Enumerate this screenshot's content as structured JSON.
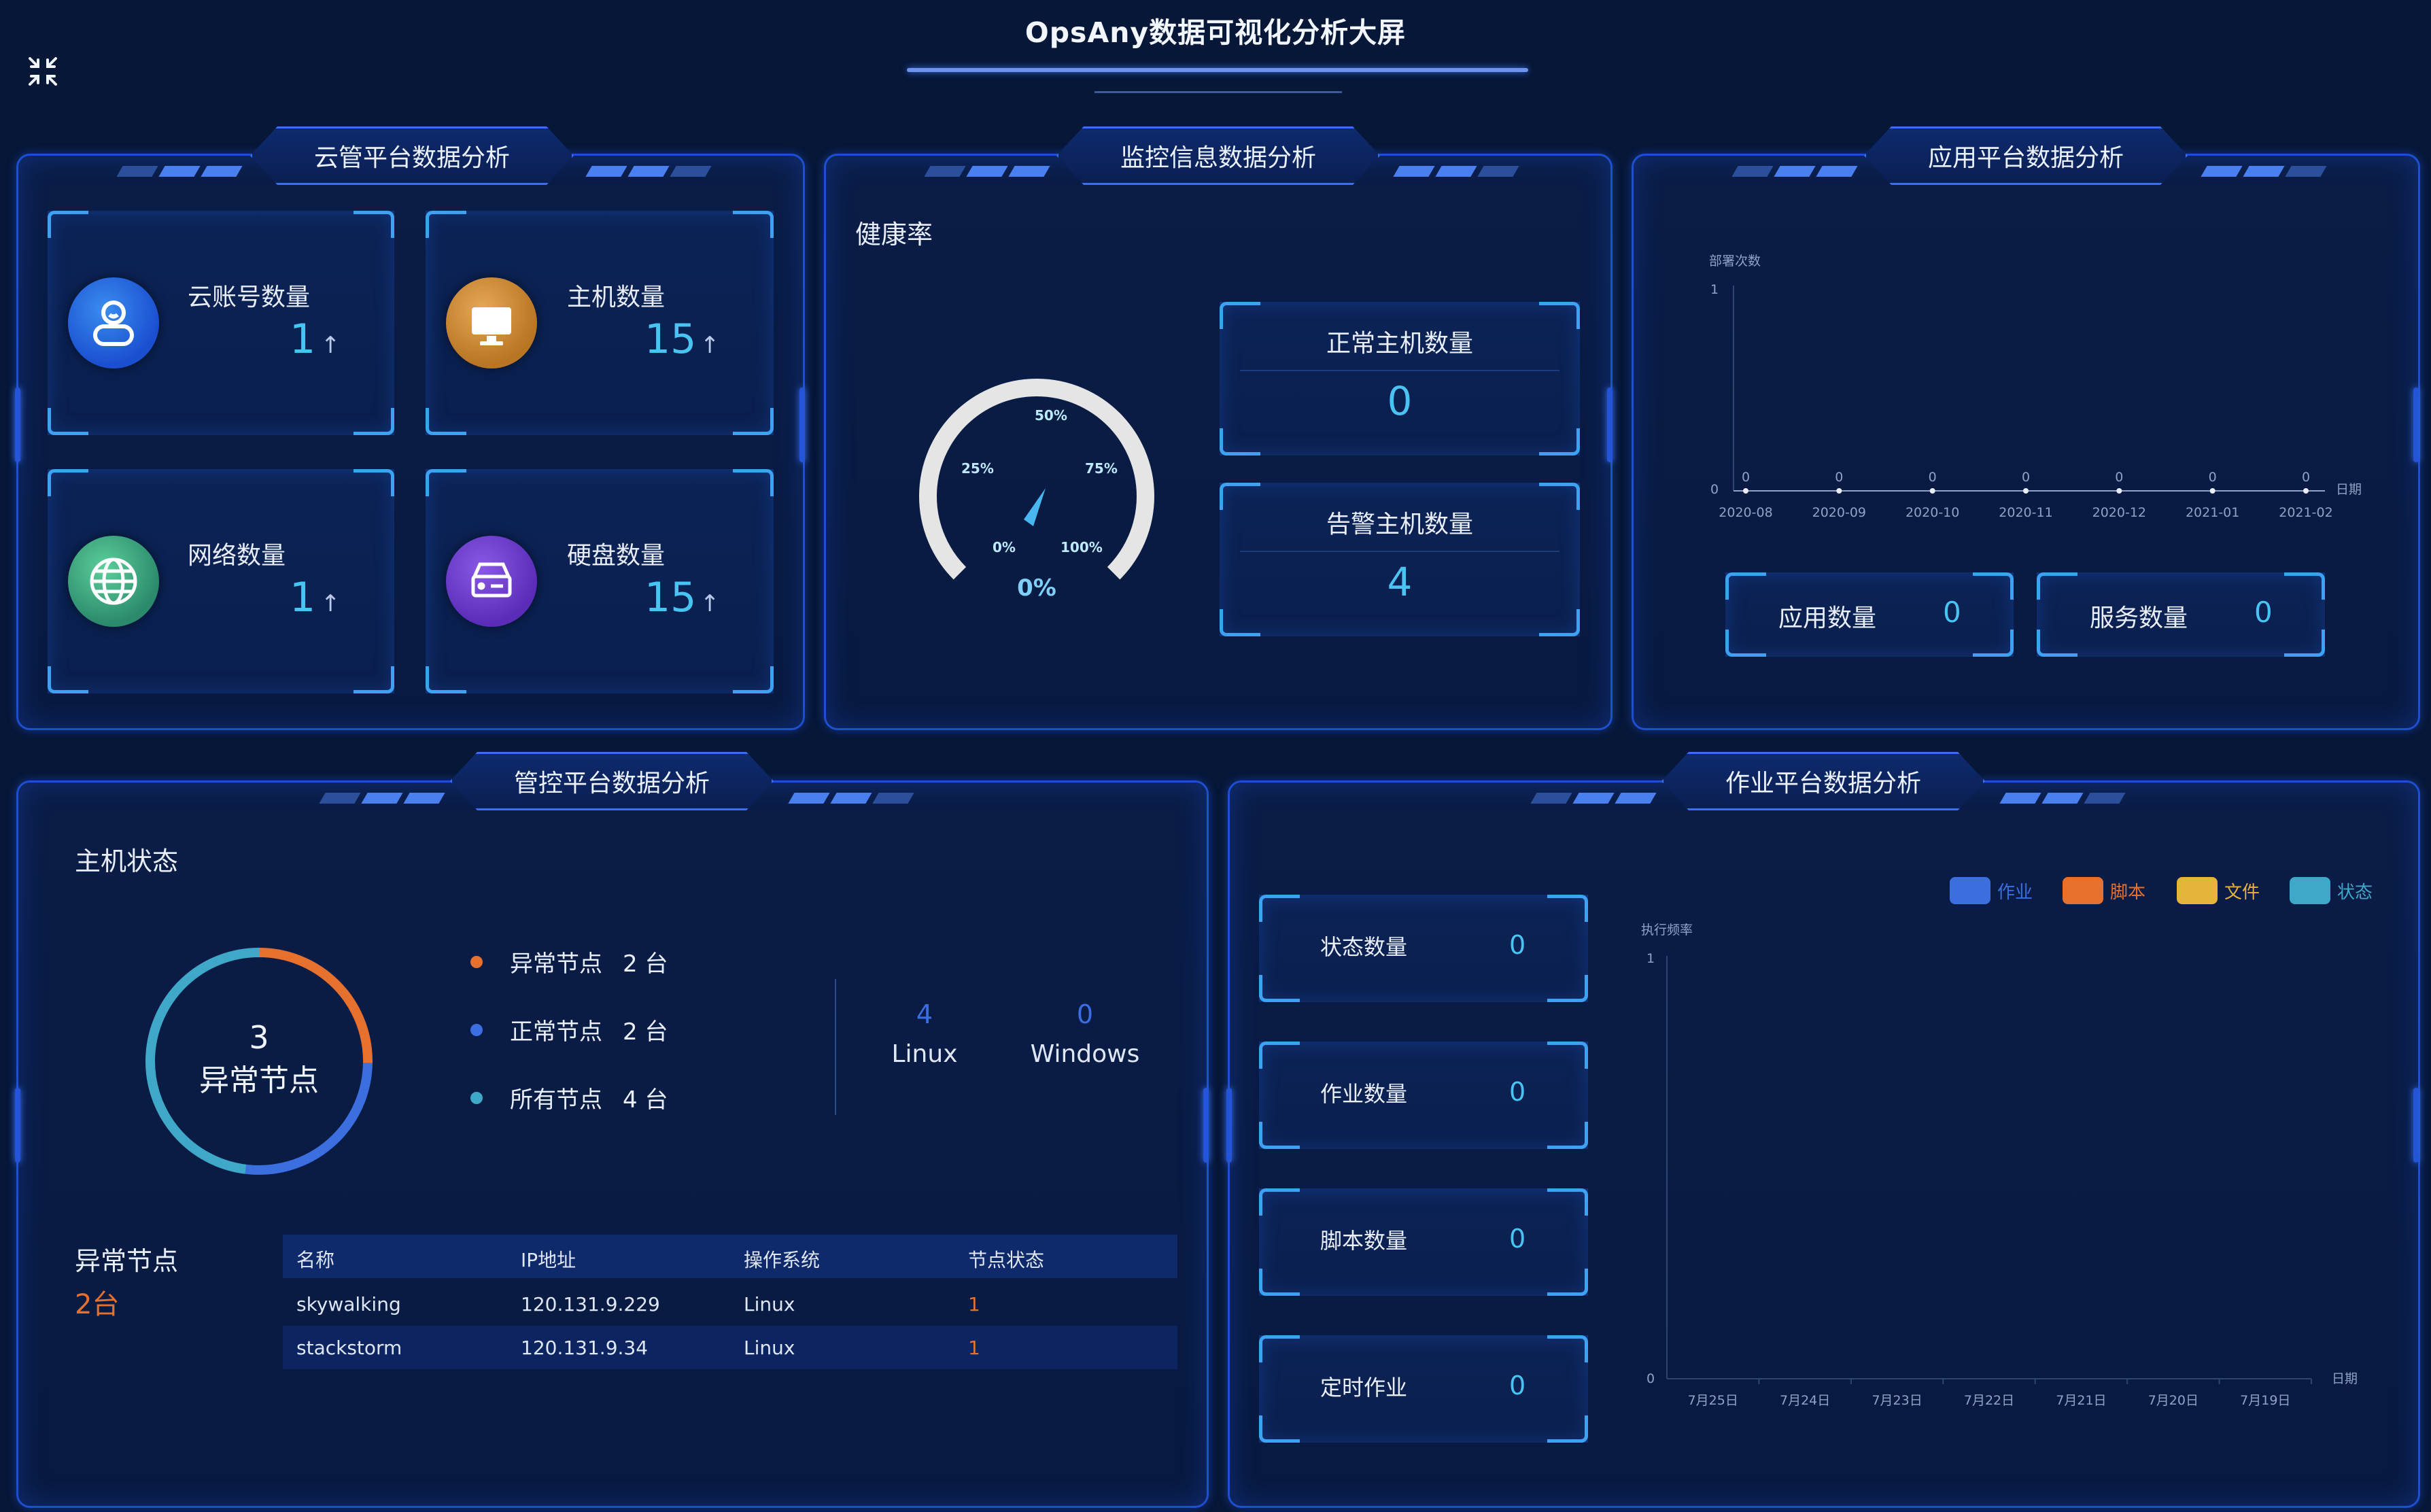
{
  "title": "OpsAny数据可视化分析大屏",
  "colors": {
    "accent": "#48c4f3",
    "orange": "#e6702e",
    "blue": "#3b6fe0",
    "teal": "#3fa8c8",
    "yellow": "#e7b43b"
  },
  "cloud": {
    "tab": "云管平台数据分析",
    "stats": [
      {
        "label": "云账号数量",
        "value": "1",
        "trend": "↑",
        "icon": "user-icon"
      },
      {
        "label": "主机数量",
        "value": "15",
        "trend": "↑",
        "icon": "monitor-icon"
      },
      {
        "label": "网络数量",
        "value": "1",
        "trend": "↑",
        "icon": "globe-icon"
      },
      {
        "label": "硬盘数量",
        "value": "15",
        "trend": "↑",
        "icon": "disk-icon"
      }
    ]
  },
  "monitor": {
    "tab": "监控信息数据分析",
    "health_label": "健康率",
    "gauge": {
      "value_text": "0%",
      "value": 0,
      "ticks": [
        "0%",
        "25%",
        "50%",
        "75%",
        "100%"
      ]
    },
    "normal_hosts": {
      "label": "正常主机数量",
      "value": "0"
    },
    "alert_hosts": {
      "label": "告警主机数量",
      "value": "4"
    }
  },
  "app": {
    "tab": "应用平台数据分析",
    "app_count": {
      "label": "应用数量",
      "value": "0"
    },
    "service_count": {
      "label": "服务数量",
      "value": "0"
    }
  },
  "manage": {
    "tab": "管控平台数据分析",
    "host_status_label": "主机状态",
    "donut": {
      "value": "3",
      "label": "异常节点"
    },
    "legend": [
      {
        "label": "异常节点",
        "value": "2 台",
        "color": "#e6702e"
      },
      {
        "label": "正常节点",
        "value": "2 台",
        "color": "#3b6fe0"
      },
      {
        "label": "所有节点",
        "value": "4 台",
        "color": "#3fa8c8"
      }
    ],
    "os": [
      {
        "count": "4",
        "name": "Linux"
      },
      {
        "count": "0",
        "name": "Windows"
      }
    ],
    "abnormal": {
      "label": "异常节点",
      "value": "2台"
    },
    "table": {
      "headers": [
        "名称",
        "IP地址",
        "操作系统",
        "节点状态"
      ],
      "rows": [
        [
          "skywalking",
          "120.131.9.229",
          "Linux",
          "1"
        ],
        [
          "stackstorm",
          "120.131.9.34",
          "Linux",
          "1"
        ]
      ]
    }
  },
  "job": {
    "tab": "作业平台数据分析",
    "stats": [
      {
        "label": "状态数量",
        "value": "0"
      },
      {
        "label": "作业数量",
        "value": "0"
      },
      {
        "label": "脚本数量",
        "value": "0"
      },
      {
        "label": "定时作业",
        "value": "0"
      }
    ]
  },
  "chart_data": [
    {
      "type": "line",
      "title": "",
      "ylabel": "部署次数",
      "xlabel": "日期",
      "x": [
        "2020-08",
        "2020-09",
        "2020-10",
        "2020-11",
        "2020-12",
        "2021-01",
        "2021-02"
      ],
      "series": [
        {
          "values": [
            0,
            0,
            0,
            0,
            0,
            0,
            0
          ]
        }
      ],
      "ylim": [
        0,
        1
      ],
      "point_labels": [
        "0",
        "0",
        "0",
        "0",
        "0",
        "0",
        "0"
      ]
    },
    {
      "type": "bar",
      "title": "",
      "ylabel": "执行频率",
      "xlabel": "日期",
      "categories": [
        "7月25日",
        "7月24日",
        "7月23日",
        "7月22日",
        "7月21日",
        "7月20日",
        "7月19日"
      ],
      "series": [
        {
          "name": "作业",
          "color": "#3b6fe0",
          "values": [
            0,
            0,
            0,
            0,
            0,
            0,
            0
          ]
        },
        {
          "name": "脚本",
          "color": "#e6702e",
          "values": [
            0,
            0,
            0,
            0,
            0,
            0,
            0
          ]
        },
        {
          "name": "文件",
          "color": "#e7b43b",
          "values": [
            0,
            0,
            0,
            0,
            0,
            0,
            0
          ]
        },
        {
          "name": "状态",
          "color": "#3fa8c8",
          "values": [
            0,
            0,
            0,
            0,
            0,
            0,
            0
          ]
        }
      ],
      "ylim": [
        0,
        1
      ],
      "legend_position": "top-right"
    }
  ]
}
